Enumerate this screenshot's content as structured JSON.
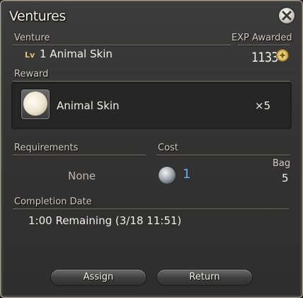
{
  "window": {
    "title": "Ventures"
  },
  "venture": {
    "section_label": "Venture",
    "level_tag": "Lv",
    "name": "1 Animal Skin",
    "exp_label": "EXP Awarded",
    "exp_value": "1133"
  },
  "reward": {
    "section_label": "Reward",
    "item_name": "Animal Skin",
    "quantity": "×5"
  },
  "requirements": {
    "section_label": "Requirements",
    "value": "None"
  },
  "cost": {
    "section_label": "Cost",
    "value": "1",
    "bag_label": "Bag",
    "bag_value": "5"
  },
  "completion": {
    "section_label": "Completion Date",
    "text": "1:00 Remaining (3/18 11:51)"
  },
  "buttons": {
    "assign": "Assign",
    "return": "Return"
  },
  "colors": {
    "accent_blue": "#5fb1e6",
    "level_gold": "#e6c36b"
  },
  "icons": {
    "close": "close-icon",
    "exp": "exp-icon",
    "item": "animal-skin-icon",
    "cost": "venture-token-icon"
  }
}
